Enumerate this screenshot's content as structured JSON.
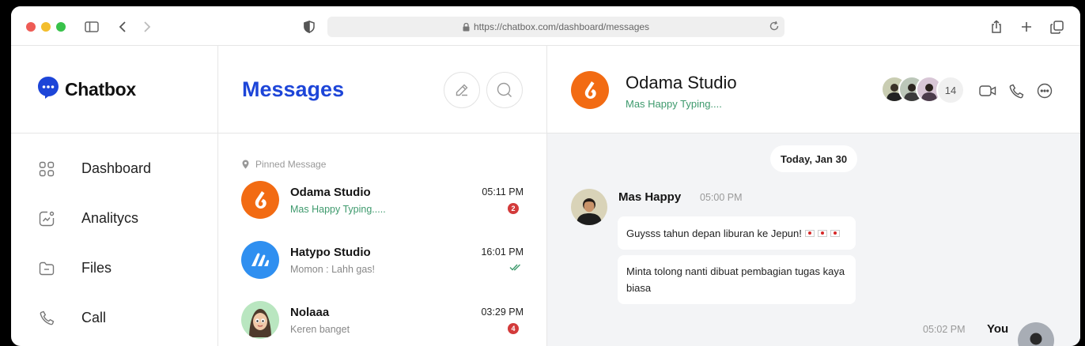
{
  "browser": {
    "url": "https://chatbox.com/dashboard/messages"
  },
  "brand": {
    "name": "Chatbox",
    "color": "#1d45d8"
  },
  "sidebar": {
    "items": [
      {
        "label": "Dashboard",
        "icon": "grid-icon"
      },
      {
        "label": "Analitycs",
        "icon": "analytics-icon"
      },
      {
        "label": "Files",
        "icon": "folder-icon"
      },
      {
        "label": "Call",
        "icon": "phone-icon"
      }
    ]
  },
  "messages": {
    "title": "Messages",
    "pinned_label": "Pinned Message",
    "conversations": [
      {
        "name": "Odama Studio",
        "preview": "Mas Happy Typing.....",
        "time": "05:11 PM",
        "unread": "2",
        "typing": true,
        "avatar_color": "#f26b13"
      },
      {
        "name": "Hatypo Studio",
        "preview": "Momon : Lahh gas!",
        "time": "16:01 PM",
        "read": true,
        "avatar_color": "#2f8ff0"
      },
      {
        "name": "Nolaaa",
        "preview": "Keren banget",
        "time": "03:29 PM",
        "unread": "4",
        "avatar_color": "#b9e6c0"
      }
    ]
  },
  "chat": {
    "name": "Odama Studio",
    "status": "Mas Happy Typing....",
    "participants_more": "14",
    "date_label": "Today, Jan 30",
    "messages": [
      {
        "sender": "Mas Happy",
        "time": "05:00 PM",
        "bubbles": [
          "Guysss tahun depan liburan ke Jepun!",
          "Minta tolong nanti dibuat pembagian tugas kaya biasa"
        ]
      }
    ],
    "you_label": "You",
    "you_time": "05:02 PM"
  },
  "colors": {
    "accent": "#1d45d8",
    "online_green": "#3e9a6d",
    "badge_red": "#d33a3a",
    "odama_orange": "#f26b13"
  }
}
